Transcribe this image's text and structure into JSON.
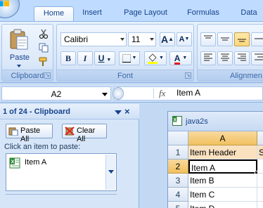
{
  "ribbon_tabs": [
    "Home",
    "Insert",
    "Page Layout",
    "Formulas",
    "Data"
  ],
  "active_tab": "Home",
  "clipboard_group": {
    "paste_label": "Paste",
    "group_label": "Clipboard"
  },
  "font_group": {
    "font_name": "Calibri",
    "font_size": "11",
    "group_label": "Font",
    "bold": "B",
    "italic": "I",
    "underline": "U",
    "grow": "A",
    "shrink": "A",
    "font_color": "A"
  },
  "alignment_group": {
    "group_label": "Alignmen"
  },
  "formula_bar": {
    "name_box": "A2",
    "fx": "fx",
    "formula": "Item A"
  },
  "clipboard_pane": {
    "title": "1 of 24 - Clipboard",
    "close": "×",
    "paste_all": "Paste All",
    "clear_all": "Clear All",
    "hint": "Click an item to paste:",
    "items": [
      "Item A"
    ]
  },
  "workbook": {
    "title": "java2s",
    "column_header": "A",
    "rows": [
      {
        "num": "1",
        "value": "Item Header",
        "next": "S"
      },
      {
        "num": "2",
        "value": "Item A",
        "next": ""
      },
      {
        "num": "3",
        "value": "Item B",
        "next": ""
      },
      {
        "num": "4",
        "value": "Item C",
        "next": ""
      },
      {
        "num": "5",
        "value": "Item D",
        "next": ""
      }
    ]
  },
  "colors": {
    "ribbon_bg": "#d7e6f9",
    "tab_text": "#15428b",
    "selected_header": "#f1c15f",
    "highlight_button": "#ffd67a",
    "font_color_bar": "#e21b1b",
    "fill_color_bar": "#ffff00"
  }
}
